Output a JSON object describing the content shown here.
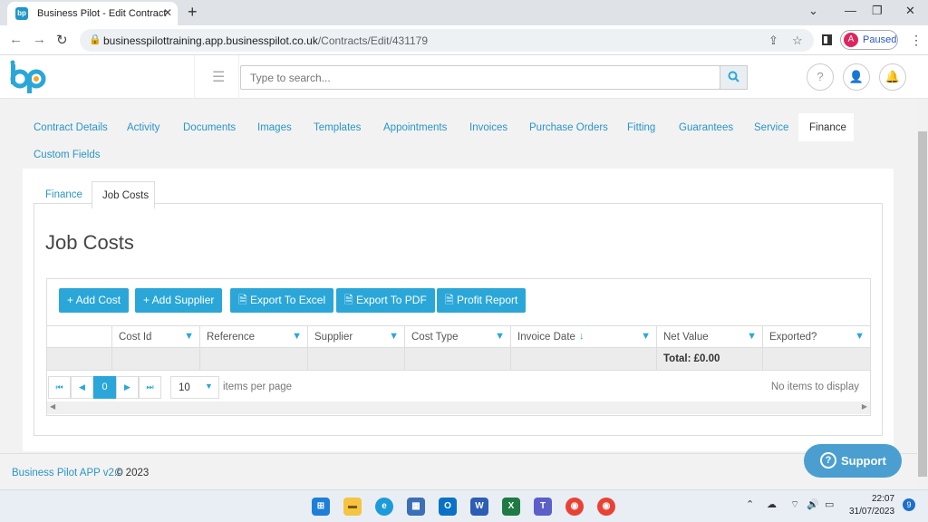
{
  "browser": {
    "tab_title": "Business Pilot - Edit Contract",
    "favicon_text": "bp",
    "url_host": "businesspilottraining.app.businesspilot.co.uk",
    "url_path": "/Contracts/Edit/431179",
    "profile_initial": "A",
    "profile_status": "Paused"
  },
  "header": {
    "search_placeholder": "Type to search...",
    "help_glyph": "?"
  },
  "top_tabs": [
    {
      "label": "Contract Details"
    },
    {
      "label": "Activity"
    },
    {
      "label": "Documents"
    },
    {
      "label": "Images"
    },
    {
      "label": "Templates"
    },
    {
      "label": "Appointments"
    },
    {
      "label": "Invoices"
    },
    {
      "label": "Purchase Orders"
    },
    {
      "label": "Fitting"
    },
    {
      "label": "Guarantees"
    },
    {
      "label": "Service"
    },
    {
      "label": "Finance",
      "active": true
    },
    {
      "label": "Custom Fields"
    }
  ],
  "sub_tabs": [
    {
      "label": "Finance"
    },
    {
      "label": "Job Costs",
      "active": true
    }
  ],
  "job_costs": {
    "title": "Job Costs",
    "buttons": {
      "add_cost": "+ Add Cost",
      "add_supplier": "+ Add Supplier",
      "export_excel": "Export To Excel",
      "export_pdf": "Export To PDF",
      "profit_report": "Profit Report"
    },
    "columns": [
      "Cost Id",
      "Reference",
      "Supplier",
      "Cost Type",
      "Invoice Date",
      "Net Value",
      "Exported?"
    ],
    "total_label": "Total: £0.00",
    "pager": {
      "current_page": "0",
      "page_size": "10",
      "items_per_page": "items per page",
      "no_items": "No items to display"
    }
  },
  "footer": {
    "app_name": "Business Pilot APP v2.0",
    "copyright": "© 2023"
  },
  "support_label": "Support",
  "taskbar": {
    "time": "22:07",
    "date": "31/07/2023",
    "notifications": "9"
  },
  "colors": {
    "accent": "#2aa7d8",
    "link": "#2a95c8",
    "support": "#4a9fd0"
  }
}
